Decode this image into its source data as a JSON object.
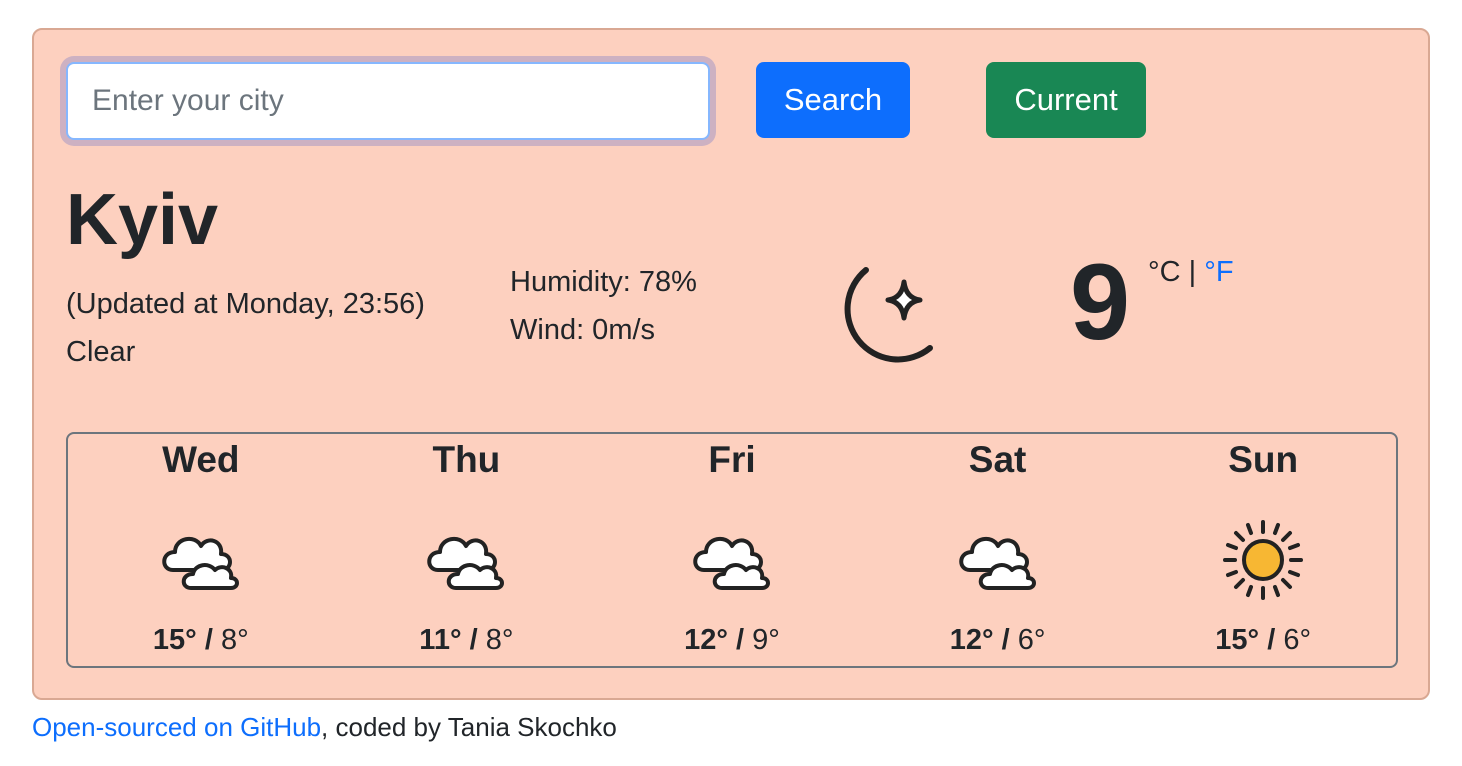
{
  "search": {
    "placeholder": "Enter your city",
    "value": ""
  },
  "buttons": {
    "search_label": "Search",
    "current_label": "Current"
  },
  "current": {
    "city": "Kyiv",
    "updated": "(Updated at Monday, 23:56)",
    "description": "Clear",
    "humidity": "Humidity: 78%",
    "wind": "Wind: 0m/s",
    "icon": "moon-clear-night-icon",
    "temperature": "9",
    "unit_celsius": "°C",
    "unit_separator": "|",
    "unit_fahrenheit": "°F"
  },
  "forecast": [
    {
      "day": "Wed",
      "icon": "cloudy-icon",
      "max": "15°",
      "min": "8°"
    },
    {
      "day": "Thu",
      "icon": "cloudy-icon",
      "max": "11°",
      "min": "8°"
    },
    {
      "day": "Fri",
      "icon": "cloudy-icon",
      "max": "12°",
      "min": "9°"
    },
    {
      "day": "Sat",
      "icon": "cloudy-icon",
      "max": "12°",
      "min": "6°"
    },
    {
      "day": "Sun",
      "icon": "sun-icon",
      "max": "15°",
      "min": "6°"
    }
  ],
  "footer": {
    "link_text": "Open-sourced on GitHub",
    "suffix": ", coded by Tania Skochko"
  },
  "colors": {
    "card_background": "#fdd0bf",
    "search_button": "#0d6efd",
    "current_button": "#198754",
    "link": "#0d6efd",
    "moon_fill": "#f5ec9a",
    "sun_fill": "#f7b733"
  }
}
